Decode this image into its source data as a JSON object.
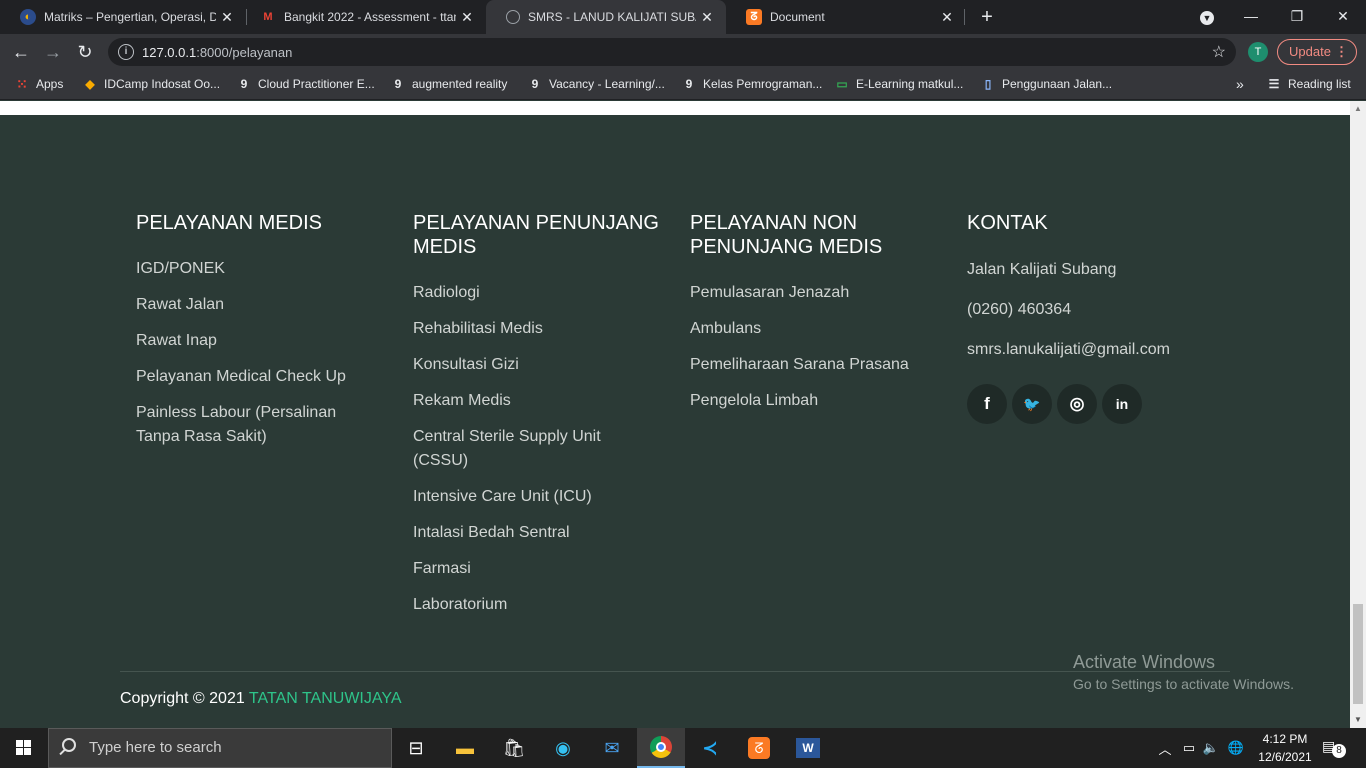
{
  "browser": {
    "tabs": [
      {
        "title": "Matriks – Pengertian, Operasi, De",
        "icon": "matriks-favicon",
        "active": false
      },
      {
        "title": "Bangkit 2022 - Assessment - ttan",
        "icon": "gmail-icon",
        "active": false
      },
      {
        "title": "SMRS - LANUD KALIJATI SUBANG",
        "icon": "globe-icon",
        "active": true
      },
      {
        "title": "Document",
        "icon": "xampp-icon",
        "active": false
      }
    ],
    "new_tab": "+",
    "url_host": "127.0.0.1",
    "url_rest": ":8000/pelayanan",
    "profile_initial": "T",
    "update_label": "Update",
    "bookmarks": [
      {
        "label": "Apps",
        "icon": "apps-grid-icon"
      },
      {
        "label": "IDCamp Indosat Oo...",
        "icon": "idcamp-icon"
      },
      {
        "label": "Cloud Practitioner E...",
        "icon": "dicoding-icon"
      },
      {
        "label": "augmented reality",
        "icon": "dicoding-icon"
      },
      {
        "label": "Vacancy - Learning/...",
        "icon": "dicoding-icon"
      },
      {
        "label": "Kelas Pemrograman...",
        "icon": "dicoding-icon"
      },
      {
        "label": "E-Learning matkul...",
        "icon": "elearning-icon"
      },
      {
        "label": "Penggunaan Jalan...",
        "icon": "document-icon"
      }
    ],
    "more_bookmarks": "»",
    "reading_list": "Reading list"
  },
  "footer": {
    "columns": [
      {
        "heading": "PELAYANAN MEDIS",
        "items": [
          "IGD/PONEK",
          "Rawat Jalan",
          "Rawat Inap",
          "Pelayanan Medical Check Up",
          "Painless Labour (Persalinan Tanpa Rasa Sakit)"
        ]
      },
      {
        "heading": "PELAYANAN PENUNJANG MEDIS",
        "items": [
          "Radiologi",
          "Rehabilitasi Medis",
          "Konsultasi Gizi",
          "Rekam Medis",
          "Central Sterile Supply Unit (CSSU)",
          "Intensive Care Unit (ICU)",
          "Intalasi Bedah Sentral",
          "Farmasi",
          "Laboratorium"
        ]
      },
      {
        "heading": "PELAYANAN NON PENUNJANG MEDIS",
        "items": [
          "Pemulasaran Jenazah",
          "Ambulans",
          "Pemeliharaan Sarana Prasana",
          "Pengelola Limbah"
        ]
      }
    ],
    "contact": {
      "heading": "KONTAK",
      "address": "Jalan Kalijati Subang",
      "phone": "(0260) 460364",
      "email": "smrs.lanukalijati@gmail.com",
      "social": [
        {
          "name": "facebook-icon",
          "glyph": "f"
        },
        {
          "name": "twitter-icon",
          "glyph": "🐦"
        },
        {
          "name": "instagram-icon",
          "glyph": "◎"
        },
        {
          "name": "linkedin-icon",
          "glyph": "in"
        }
      ]
    },
    "copyright_prefix": "Copyright © 2021",
    "copyright_brand": "TATAN TANUWIJAYA",
    "brand_color": "#2ec48a"
  },
  "watermark": {
    "line1": "Activate Windows",
    "line2": "Go to Settings to activate Windows."
  },
  "taskbar": {
    "search_placeholder": "Type here to search",
    "apps": [
      "task-view-icon",
      "file-explorer-icon",
      "store-icon",
      "edge-icon",
      "mail-icon",
      "chrome-icon",
      "vscode-icon",
      "xampp-icon",
      "word-icon"
    ],
    "time": "4:12 PM",
    "date": "12/6/2021",
    "notification_count": "8"
  }
}
